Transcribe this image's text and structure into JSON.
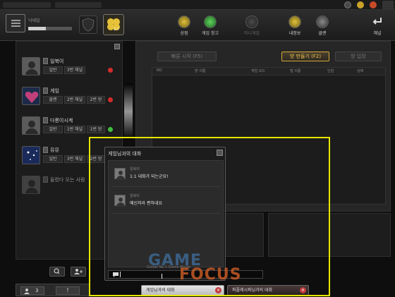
{
  "toolbar": {
    "user_label": "닉네임",
    "clover_level": "2.7",
    "buttons": [
      "상점",
      "게임 창고",
      "미니게임",
      "내정보",
      "클랜",
      "채널"
    ]
  },
  "users": [
    {
      "name": "일북이",
      "cells": [
        "일반",
        "3번 채널"
      ],
      "status_color": "#d42b2b"
    },
    {
      "name": "게임",
      "cells": [
        "클랜",
        "2번 채널",
        "2번 방"
      ],
      "status_color": "#d42b2b"
    },
    {
      "name": "다롱이시계",
      "cells": [
        "일반",
        "1번 채널",
        "1번 방"
      ],
      "status_color": "#3fbf3f"
    },
    {
      "name": "뮤뮤",
      "cells": [
        "일반",
        "3번 채널",
        "2번 방"
      ],
      "status_color": "#d42b2b"
    },
    {
      "name": "들렀다 오는 사람",
      "cells": [],
      "status_color": ""
    }
  ],
  "left_footer": {
    "search_icon": "search-icon",
    "add_friend_icon": "add-user-icon",
    "user_count": "3",
    "alert_icon": "exclamation-icon"
  },
  "room": {
    "quick_start": "빠른 시작 (F5)",
    "create_room": "방 만들기 (F2)",
    "enter_room": "방 입장",
    "columns": [
      "NO",
      "방 이름",
      "게임 모드",
      "맵 이름",
      "인원",
      "상태"
    ]
  },
  "chat": {
    "title": "게임님과의 대화",
    "messages": [
      {
        "sender": "일북이",
        "text": "1:1 대화가 되는군요!"
      },
      {
        "sender": "일북이",
        "text": "메신저라 편하네요"
      }
    ],
    "footer": "Global No.1 Game Media",
    "input_value": "",
    "input_icon": "speech-bubble-icon"
  },
  "chat_tabs": [
    {
      "label": "게임님과의 대화",
      "active": true
    },
    {
      "label": "퍼플레시퍼님과의 대화",
      "active": false
    }
  ],
  "watermark": {
    "line1": "GAME",
    "line2": "FOCUS"
  },
  "colors": {
    "accent": "#e6a800",
    "highlight": "#e6e600",
    "online": "#3fbf3f",
    "offline": "#d42b2b"
  }
}
